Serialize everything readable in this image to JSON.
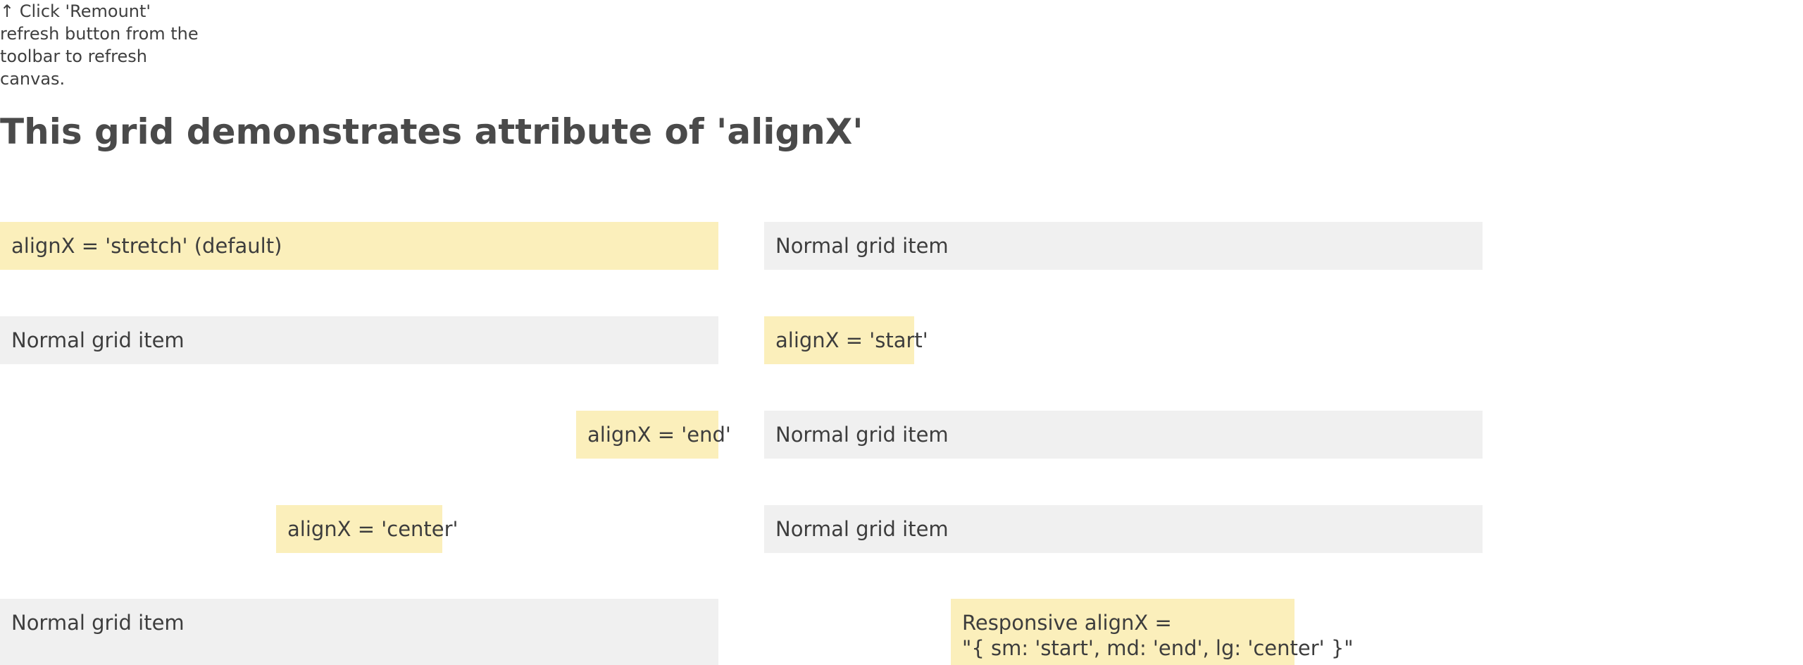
{
  "notice": {
    "text": "↑ Click 'Remount' refresh button from the toolbar to refresh canvas."
  },
  "page": {
    "title": "This grid demonstrates attribute of 'alignX'"
  },
  "grid": {
    "items": [
      {
        "label": "alignX = 'stretch' (default)",
        "kind": "highlight"
      },
      {
        "label": "Normal grid item",
        "kind": "normal"
      },
      {
        "label": "Normal grid item",
        "kind": "normal"
      },
      {
        "label": "alignX = 'start'",
        "kind": "highlight"
      },
      {
        "label": "alignX = 'end'",
        "kind": "highlight"
      },
      {
        "label": "Normal grid item",
        "kind": "normal"
      },
      {
        "label": "alignX = 'center'",
        "kind": "highlight"
      },
      {
        "label": "Normal grid item",
        "kind": "normal"
      },
      {
        "label": "Normal grid item",
        "kind": "normal"
      },
      {
        "label_line1": "Responsive alignX =",
        "label_line2": "\"{ sm: 'start', md: 'end', lg: 'center' }\"",
        "kind": "highlight"
      }
    ]
  },
  "colors": {
    "highlight_bg": "#fbefbb",
    "normal_bg": "#f0f0f0",
    "text": "#3d3d3d"
  }
}
